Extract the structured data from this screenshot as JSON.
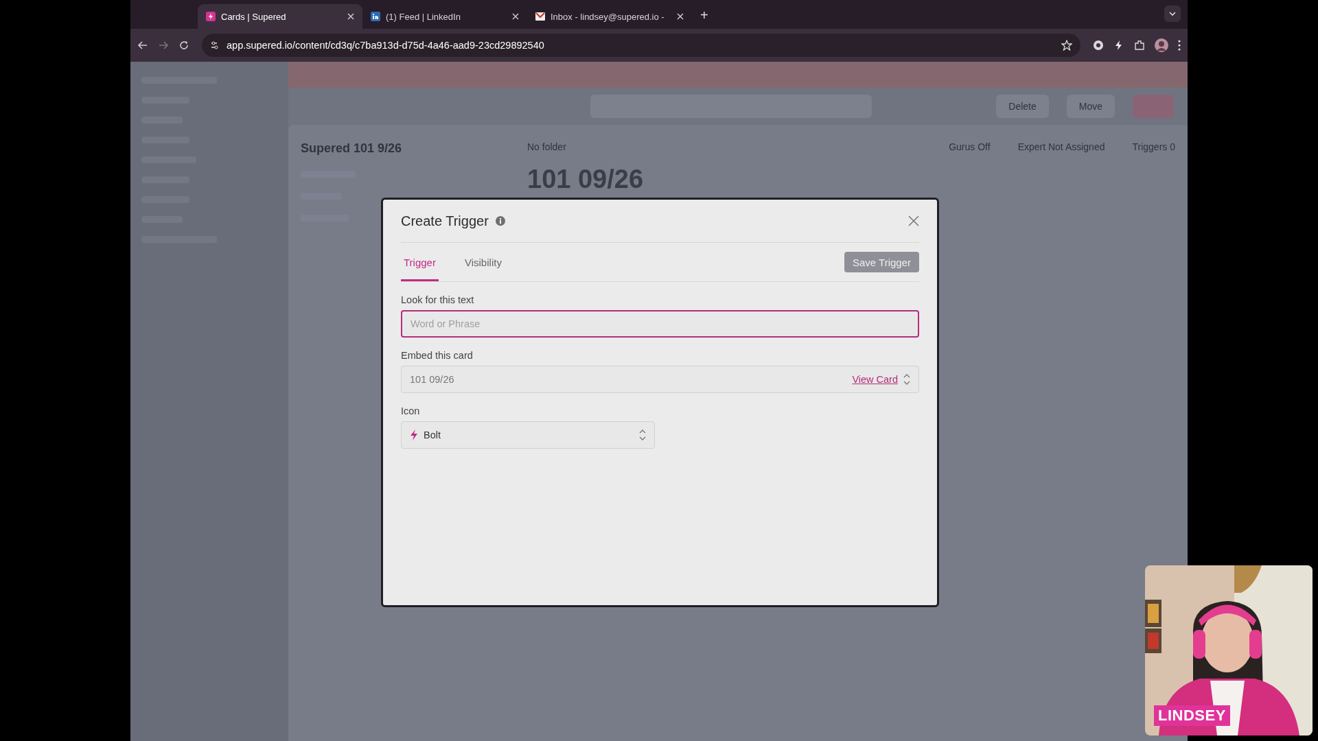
{
  "browser": {
    "tabs": [
      {
        "title": "Cards | Supered",
        "selected": true
      },
      {
        "title": "(1) Feed | LinkedIn",
        "selected": false
      },
      {
        "title": "Inbox - lindsey@supered.io -",
        "selected": false
      }
    ],
    "new_tab": "+",
    "url": "app.supered.io/content/cd3q/c7ba913d-d75d-4a46-aad9-23cd29892540"
  },
  "background_page": {
    "card_list_title": "Supered 101 9/26",
    "folder": "No folder",
    "card_title": "101 09/26",
    "meta": [
      "Gurus Off",
      "Expert Not Assigned",
      "Triggers 0"
    ],
    "buttons": [
      "Delete",
      "Move"
    ]
  },
  "modal": {
    "title": "Create Trigger",
    "tabs": [
      {
        "label": "Trigger",
        "selected": true
      },
      {
        "label": "Visibility",
        "selected": false
      }
    ],
    "save_button": {
      "label": "Save Trigger",
      "disabled": true
    },
    "fields": [
      {
        "label": "Look for this text",
        "kind": "text",
        "placeholder": "Word or Phrase",
        "focused": true
      },
      {
        "label": "Embed this card",
        "kind": "card",
        "value": "101 09/26",
        "link": "View Card"
      },
      {
        "label": "Icon",
        "kind": "select",
        "value": "Bolt"
      }
    ]
  },
  "webcam": {
    "kind": "picture",
    "name": "LINDSEY"
  }
}
